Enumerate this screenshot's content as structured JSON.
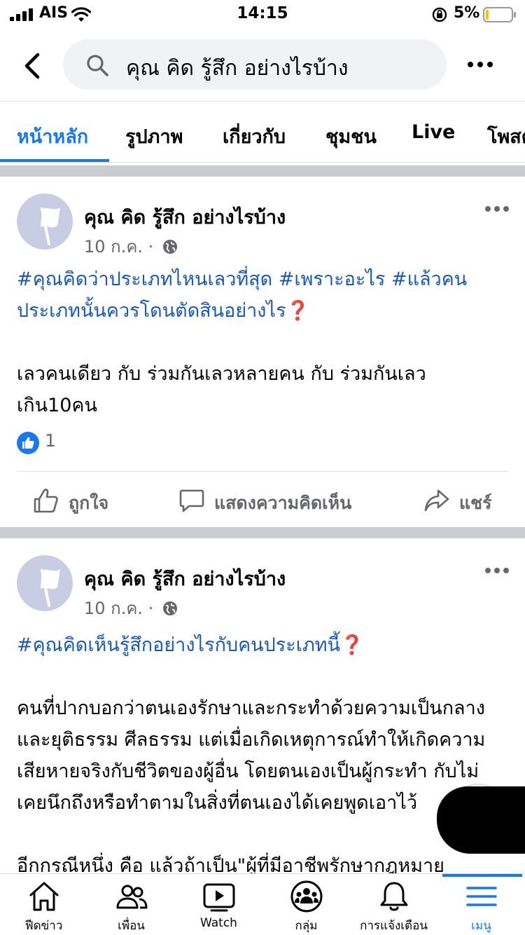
{
  "status_bar": {
    "carrier": "AIS",
    "time": "14:15",
    "battery_percent": "5%"
  },
  "search": {
    "query": "คุณ คิด รู้สึก อย่างไรบ้าง"
  },
  "tabs": [
    {
      "label": "หน้าหลัก",
      "active": true
    },
    {
      "label": "รูปภาพ"
    },
    {
      "label": "เกี่ยวกับ"
    },
    {
      "label": "ชุมชน"
    },
    {
      "label": "Live"
    },
    {
      "label": "โพสต์"
    }
  ],
  "posts": [
    {
      "author": "คุณ คิด รู้สึก อย่างไรบ้าง",
      "date": "10 ก.ค. ·",
      "hashtag_line1": "#คุณคิดว่าประเภทไหนเลวที่สุด #เพราะอะไร #แล้วคน",
      "hashtag_line2": "ประเภทนั้นควรโดนตัดสินอย่างไร",
      "emoji": "❓",
      "body_line1": "เลวคนเดียว กับ ร่วมกันเลวหลายคน กับ ร่วมกันเลว",
      "body_line2": "เกิน10คน",
      "like_count": "1",
      "actions": {
        "like": "ถูกใจ",
        "comment": "แสดงความคิดเห็น",
        "share": "แชร์"
      }
    },
    {
      "author": "คุณ คิด รู้สึก อย่างไรบ้าง",
      "date": "10 ก.ค. ·",
      "hashtag_line1": "#คุณคิดเห็นรู้สึกอย่างไรกับคนประเภทนี้",
      "emoji": "❓",
      "body_lines": [
        "คนที่ปากบอกว่าตนเองรักษาและกระทำด้วยความเป็นกลาง",
        "และยุติธรรม ศีลธรรม แต่เมื่อเกิดเหตุการณ์ทำให้เกิดความ",
        "เสียหายจริงกับชีวิตของผู้อื่น โดยตนเองเป็นผู้กระทำ กับไม่",
        "เคยนึกถึงหรือทำตามในสิ่งที่ตนเองได้เคยพูดเอาไว้"
      ],
      "body_line_cut": "อีกกรณีหนึ่ง คือ แล้วถ้าเป็น\"ผู้ที่มีอาชีพรักษากฎหมาย"
    }
  ],
  "bottom_nav": [
    {
      "label": "ฟีดข่าว",
      "icon": "home-icon"
    },
    {
      "label": "เพื่อน",
      "icon": "friends-icon"
    },
    {
      "label": "Watch",
      "icon": "watch-icon"
    },
    {
      "label": "กลุ่ม",
      "icon": "groups-icon"
    },
    {
      "label": "การแจ้งเตือน",
      "icon": "bell-icon"
    },
    {
      "label": "เมนู",
      "icon": "menu-icon",
      "active": true
    }
  ],
  "colors": {
    "accent": "#1877f2",
    "hashtag": "#1b59b8",
    "muted": "#65676b",
    "separator": "#c9ccd1"
  }
}
